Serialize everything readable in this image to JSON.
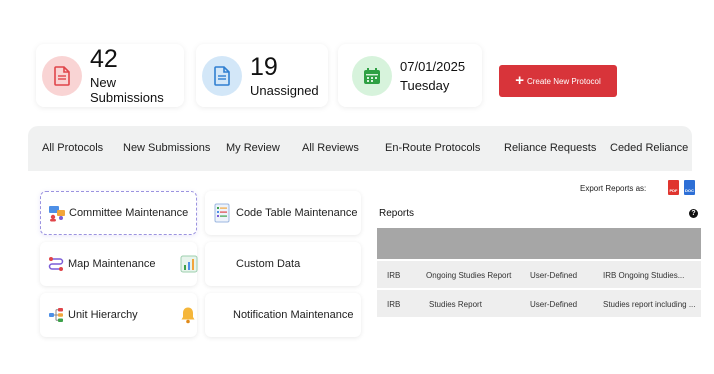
{
  "stats": {
    "new_submissions": {
      "value": "42",
      "label": "New Submissions",
      "icon": "document-icon",
      "color": "#f9d4d4"
    },
    "unassigned": {
      "value": "19",
      "label": "Unassigned",
      "icon": "document-icon",
      "color": "#d3e7f8"
    },
    "date": {
      "value": "07/01/2025",
      "label": "Tuesday",
      "icon": "calendar-icon",
      "color": "#d7f3dc"
    }
  },
  "create_button": {
    "label": "Create New Protocol",
    "color": "#d8343a"
  },
  "tabs": [
    "All Protocols",
    "New Submissions",
    "My Review",
    "All Reviews",
    "En-Route Protocols",
    "Reliance Requests",
    "Ceded Reliance"
  ],
  "menu": {
    "committee": "Committee Maintenance",
    "code_table": "Code Table Maintenance",
    "map": "Map Maintenance",
    "custom_data": "Custom Data",
    "unit_hierarchy": "Unit Hierarchy",
    "notification": "Notification Maintenance"
  },
  "export": {
    "label": "Export Reports as:",
    "pdf": "PDF",
    "doc": "DOC"
  },
  "reports": {
    "title": "Reports",
    "help": "?",
    "rows": [
      [
        "IRB",
        "Ongoing Studies Report",
        "User-Defined",
        "IRB Ongoing Studies..."
      ],
      [
        "IRB",
        "Studies Report",
        "User-Defined",
        "Studies report including ..."
      ]
    ]
  }
}
